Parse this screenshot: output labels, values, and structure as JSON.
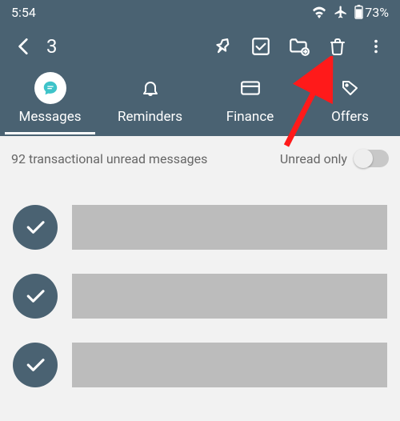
{
  "status": {
    "time": "5:54",
    "battery": "73%"
  },
  "appbar": {
    "selected_count": "3"
  },
  "tabs": {
    "messages": "Messages",
    "reminders": "Reminders",
    "finance": "Finance",
    "offers": "Offers"
  },
  "filter": {
    "summary": "92  transactional unread messages",
    "toggle_label": "Unread only"
  }
}
